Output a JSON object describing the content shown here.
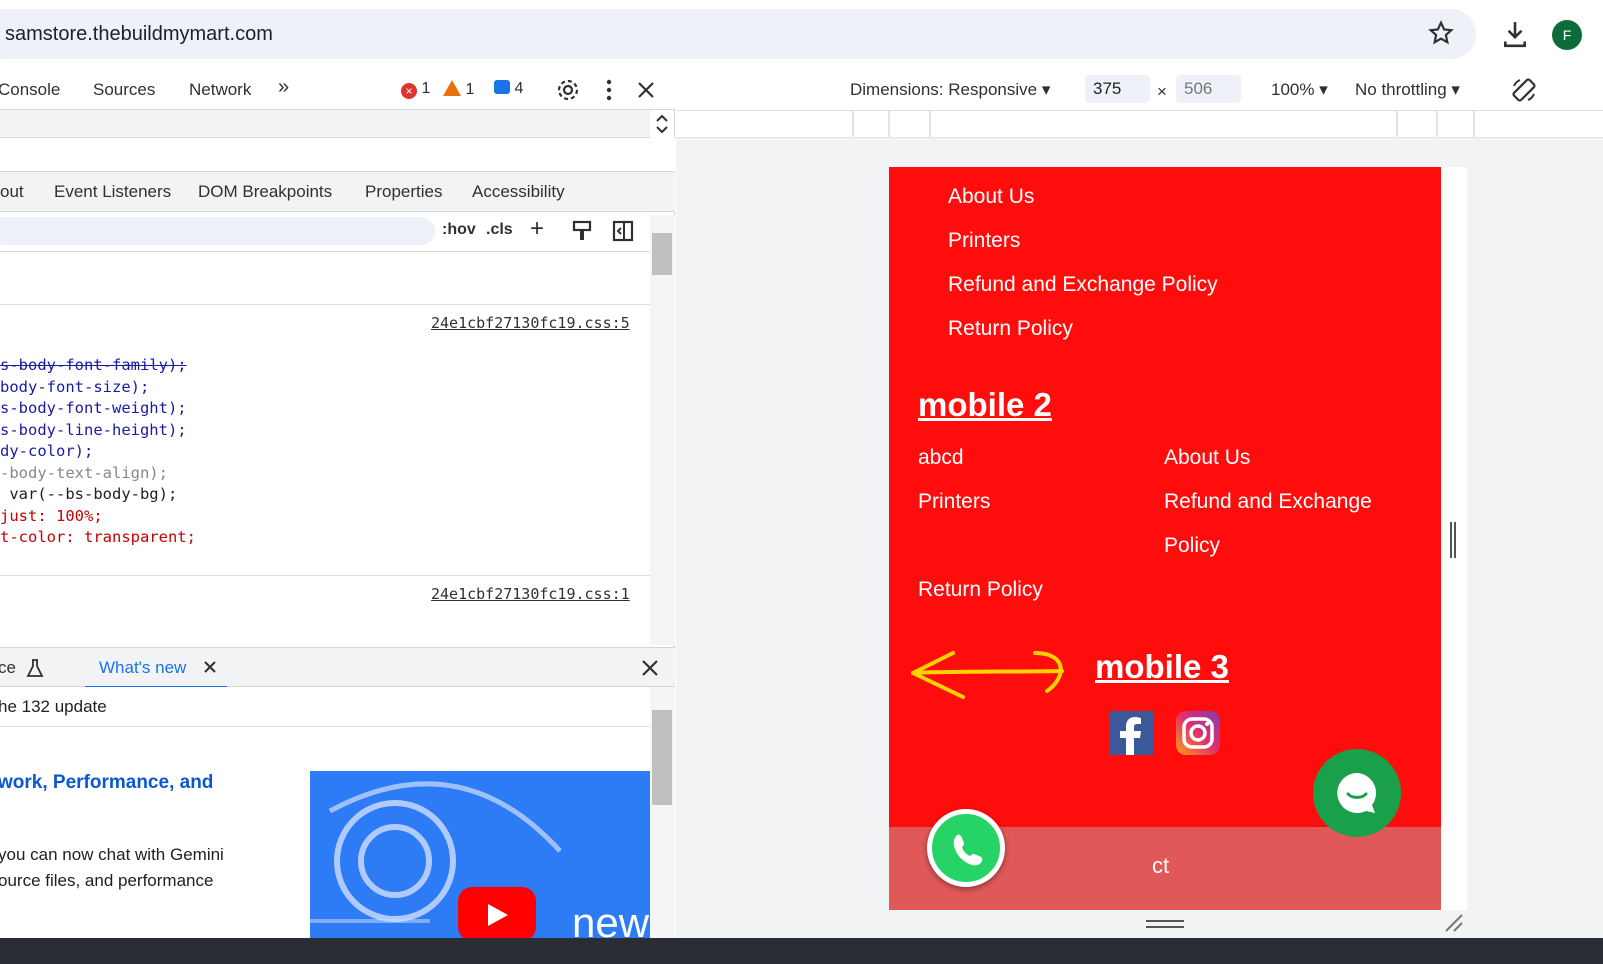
{
  "browser": {
    "url": "samstore.thebuildmymart.com",
    "avatar_letter": "F"
  },
  "devtools": {
    "tabs": [
      "Console",
      "Sources",
      "Network"
    ],
    "more_tabs": "»",
    "errors": "1",
    "warnings": "1",
    "messages": "4",
    "sub_tabs": [
      "out",
      "Event Listeners",
      "DOM Breakpoints",
      "Properties",
      "Accessibility"
    ],
    "filter_tools": {
      "hov": ":hov",
      "cls": ".cls",
      "add": "+"
    },
    "rules": [
      {
        "source": "24e1cbf27130fc19.css:5",
        "lines": [
          "s-body-font-family);",
          "body-font-size);",
          "s-body-font-weight);",
          "s-body-line-height);",
          "dy-color);",
          "-body-text-align);",
          " var(--bs-body-bg);",
          "just: 100%;",
          "t-color: transparent;"
        ]
      },
      {
        "source": "24e1cbf27130fc19.css:1"
      }
    ],
    "drawer": {
      "tab_partial": "ce",
      "tab_active": "What's new",
      "update_title": "he 132 update",
      "article_heading": "work, Performance, and",
      "article_line1": " you can now chat with Gemini",
      "article_line2": "ource files, and performance",
      "video_text": "new"
    }
  },
  "emulation": {
    "dimensions_label": "Dimensions: Responsive",
    "width": "375",
    "height": "506",
    "times": "×",
    "zoom": "100%",
    "throttling": "No throttling"
  },
  "page": {
    "menu1": [
      "About Us",
      "Printers",
      "Refund and Exchange Policy",
      "Return Policy"
    ],
    "heading2": "mobile 2",
    "menu2_col1": [
      "abcd",
      "Printers",
      "Return Policy"
    ],
    "menu2_col2": [
      "About Us",
      "Refund and Exchange",
      "Policy"
    ],
    "heading3": "mobile 3",
    "footer_text": "ct"
  },
  "colors": {
    "page_red": "#ff0d0d",
    "footer": "#e05858",
    "chat_green": "#1aa04a",
    "arrow_yellow": "#ffd200",
    "devtools_blue": "#1a73e8"
  }
}
